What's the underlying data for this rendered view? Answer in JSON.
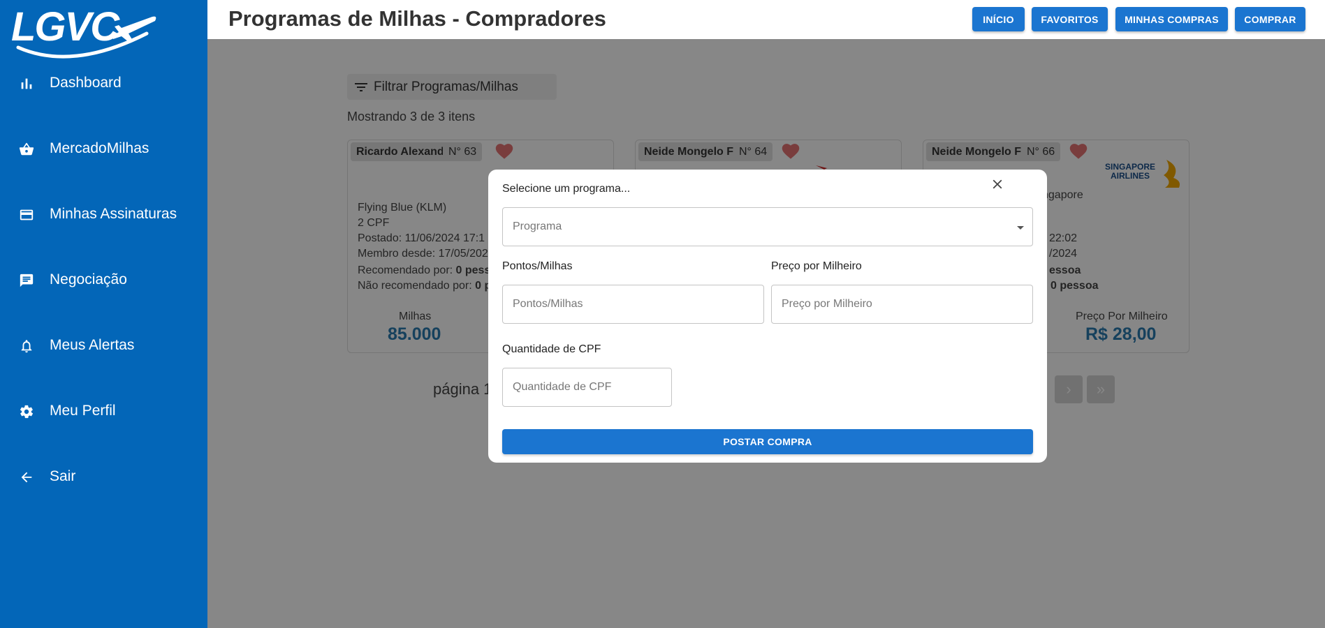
{
  "app": {
    "logo_text": "LGVC",
    "page_title": "Programas de Milhas - Compradores",
    "accent_color": "#1b75d0",
    "sidebar_color": "#0366b8"
  },
  "sidebar": {
    "items": [
      {
        "label": "Dashboard",
        "icon": "bar-chart-icon"
      },
      {
        "label": "MercadoMilhas",
        "icon": "basket-icon"
      },
      {
        "label": "Minhas Assinaturas",
        "icon": "credit-card-icon"
      },
      {
        "label": "Negociação",
        "icon": "chat-icon"
      },
      {
        "label": "Meus Alertas",
        "icon": "bell-icon"
      },
      {
        "label": "Meu Perfil",
        "icon": "gear-icon"
      },
      {
        "label": "Sair",
        "icon": "arrow-left-icon"
      }
    ]
  },
  "header": {
    "buttons": [
      "INÍCIO",
      "FAVORITOS",
      "MINHAS COMPRAS",
      "COMPRAR"
    ]
  },
  "list": {
    "filter_label": "Filtrar Programas/Milhas",
    "count_text": "Mostrando 3 de 3 itens",
    "cards": [
      {
        "name": "Ricardo Alexand",
        "number": "N° 63",
        "program": "Flying Blue (KLM)",
        "cpf": "2 CPF",
        "posted": "Postado: 11/06/2024 17:1",
        "member_since": "Membro desde: 17/05/202",
        "recommended_label": "Recomendado por: ",
        "recommended_value": "0 pesso",
        "not_recommended_label": "Não recomendado por: ",
        "not_recommended_value": "0 p",
        "metric_label": "Milhas",
        "metric_value": "85.000"
      },
      {
        "name": "Neide Mongelo F",
        "number": "N° 64"
      },
      {
        "name": "Neide Mongelo F",
        "number": "N° 66",
        "program": "ngapore",
        "posted": "22:02",
        "member_since": "/2024",
        "recommended_value": "essoa",
        "not_recommended_value": "0 pessoa",
        "metric_label": "Preço Por Milheiro",
        "metric_value": "R$ 28,00",
        "logo_text_1": "SINGAPORE",
        "logo_text_2": "AIRLINES"
      }
    ],
    "pagination_text": "página 1",
    "next_symbol": "›",
    "last_symbol": "»"
  },
  "modal": {
    "select_label": "Selecione um programa...",
    "select_placeholder": "Programa",
    "points_label": "Pontos/Milhas",
    "points_placeholder": "Pontos/Milhas",
    "price_label": "Preço por Milheiro",
    "price_placeholder": "Preço por Milheiro",
    "cpf_label": "Quantidade de CPF",
    "cpf_placeholder": "Quantidade de CPF",
    "submit_label": "POSTAR COMPRA"
  }
}
